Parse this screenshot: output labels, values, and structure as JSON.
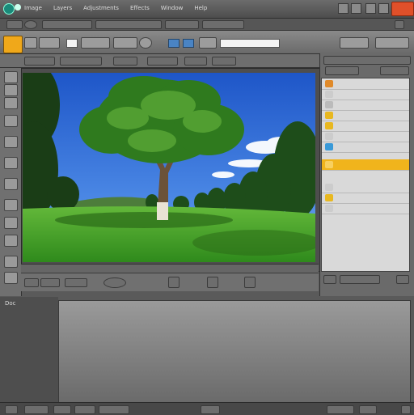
{
  "app": {
    "menu": [
      "Image",
      "Layers",
      "Adjustments",
      "Effects",
      "Window",
      "Help"
    ]
  },
  "colors": {
    "accent_orange": "#e0502a",
    "selected_layer": "#f0b41c",
    "panel_bg": "#6a6a6a",
    "sky": "#2f6ad8",
    "grass": "#3fa12a"
  },
  "icons": [
    "folder-icon",
    "brush-icon",
    "crop-icon",
    "eraser-icon",
    "zoom-icon",
    "layer-icon",
    "close-icon"
  ],
  "layers_panel": {
    "selected_index": 7
  },
  "status": {
    "left_text": "Doc"
  }
}
